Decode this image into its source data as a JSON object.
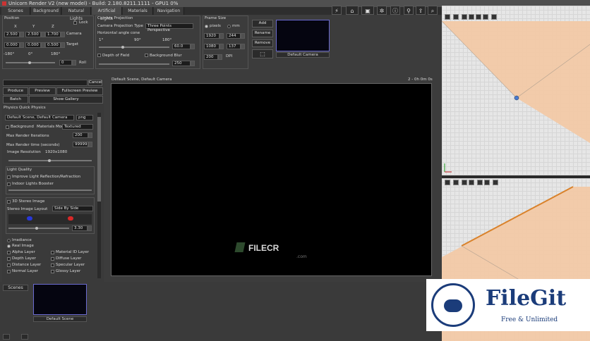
{
  "app": {
    "title": "Unicorn Render V2 (new model) - Build: 2.180.8211.1111 - GPU1 0%"
  },
  "tabs": [
    "Scenes",
    "Background",
    "Natural Lights",
    "Artificial Lights",
    "Materials",
    "Navigation"
  ],
  "position": {
    "title": "Position",
    "lock_label": "Lock",
    "col_x": "X",
    "col_y": "Y",
    "col_z": "Z",
    "camera_label": "Camera",
    "target_label": "Target",
    "camera": [
      "2.500",
      "2.500",
      "1.700"
    ],
    "target": [
      "0.000",
      "0.000",
      "0.500"
    ],
    "angle_ticks": [
      "-180°",
      "0°",
      "180°"
    ],
    "roll_value": "0",
    "roll_label": "Roll"
  },
  "camera_projection": {
    "title": "Camera Projection",
    "type_label": "Camera Projection Type",
    "type_value": "Three Points Perspective",
    "horizontal_label": "Horizontal angle cone",
    "h_ticks": [
      "1°",
      "90°",
      "180°"
    ],
    "h_value": "60.0",
    "dof_label": "Depth of Field",
    "bg_blur_label": "Background Blur",
    "blur_value": "250"
  },
  "frame_size": {
    "title": "Frame Size",
    "pixels_label": "pixels",
    "mm_label": "mm",
    "width": "1920",
    "width_mm": "244",
    "height": "1080",
    "height_mm": "137",
    "dpi_value": "200",
    "dpi_label": "DPI"
  },
  "camera_buttons": {
    "add": "Add",
    "rename": "Rename",
    "remove": "Remove"
  },
  "camera_thumb_label": "Default Camera",
  "render_panel": {
    "cancel": "Cancel",
    "produce": "Produce",
    "preview": "Preview",
    "fullscreen": "Fullscreen Preview",
    "batch": "Batch",
    "gallery": "Show Gallery",
    "subtabs": [
      "Physics",
      "Quick Physics"
    ],
    "scene_camera": "Default Scene, Default Camera",
    "format": "png",
    "background_label": "Background",
    "materials_mode_label": "Materials Mode",
    "materials_mode_value": "Textured",
    "max_iter_label": "Max Render Iterations",
    "max_iter_value": "200",
    "max_time_label": "Max Render time (seconds)",
    "max_time_value": "99999",
    "resolution_label": "Image Resolution",
    "resolution_value": "1920x1080",
    "light_quality_title": "Light Quality",
    "improve_label": "Improve Light Reflection/Refraction",
    "indoor_label": "Indoor Lights Booster",
    "stereo_title": "3D Stereo Image",
    "stereo_layout_label": "Stereo Image Layout",
    "stereo_layout_value": "Side By Side",
    "stereo_value": "3.30",
    "irradiance_label": "Irradiance",
    "real_image_label": "Real Image",
    "layers_left": [
      "Alpha Layer",
      "Depth Layer",
      "Distance Layer",
      "Normal Layer"
    ],
    "layers_right": [
      "Material ID Layer",
      "Diffuse Layer",
      "Specular Layer",
      "Glossy Layer"
    ]
  },
  "viewport": {
    "title": "Default Scene, Default Camera",
    "status": "2 - 0h 0m 0s"
  },
  "watermark": {
    "brand": "FILECR",
    "sub": ".com"
  },
  "scenes_bar": {
    "tab": "Scenes",
    "thumb_label": "Default Scene"
  },
  "badge": {
    "title": "FileGit",
    "subtitle": "Free & Unlimited"
  },
  "colors": {
    "accent": "#5a5aa8",
    "orange_plane": "#f2c9a6",
    "edge": "#d9822b"
  }
}
